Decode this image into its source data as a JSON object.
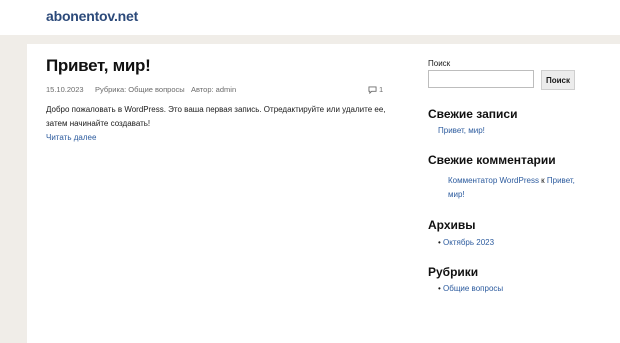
{
  "site": {
    "title": "abonentov.net"
  },
  "post": {
    "title": "Привет, мир!",
    "date": "15.10.2023",
    "category": "Рубрика: Общие вопросы",
    "author": "Автор: admin",
    "comments_count": "1",
    "excerpt": "Добро пожаловать в WordPress. Это ваша первая запись. Отредактируйте или удалите ее, затем начинайте создавать!",
    "read_more": "Читать далее"
  },
  "sidebar": {
    "search": {
      "label": "Поиск",
      "value": "",
      "button": "Поиск"
    },
    "recent_posts": {
      "title": "Свежие записи",
      "items": [
        "Привет, мир!"
      ]
    },
    "recent_comments": {
      "title": "Свежие комментарии",
      "author_link": "Комментатор WordPress",
      "connector": " к ",
      "post_link": "Привет, мир!"
    },
    "archives": {
      "title": "Архивы",
      "items": [
        "Октябрь 2023"
      ]
    },
    "categories": {
      "title": "Рубрики",
      "items": [
        "Общие вопросы"
      ]
    }
  },
  "colors": {
    "link": "#2c5b9e",
    "site_title": "#2c4a7a",
    "background": "#f0ede8"
  }
}
